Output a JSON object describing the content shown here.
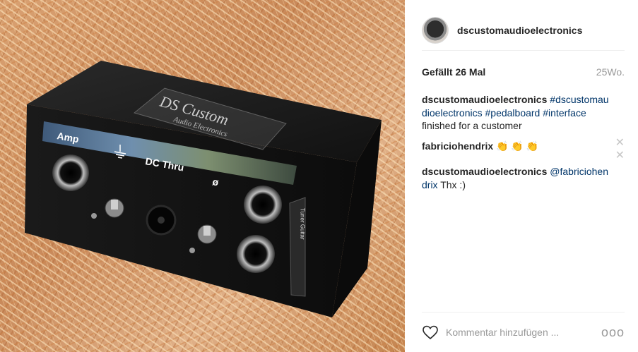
{
  "post": {
    "username": "dscustomaudioelectronics",
    "likes": "Gefällt 26 Mal",
    "time": "25Wo."
  },
  "photo": {
    "panel_top_left": "Amp",
    "panel_top_mid": "DC Thru",
    "panel_top_right": "ø",
    "logo_line1": "DS Custom",
    "logo_line2": "Audio Electronics",
    "side_label": "Tuner Guitar"
  },
  "comments": [
    {
      "user": "dscustomaudioelectronics",
      "tags": [
        "#dscustomaudioelectronics",
        "#pedalboard",
        "#interface"
      ],
      "text": "finished for a customer"
    },
    {
      "user": "fabriciohendrix",
      "text": "👏 👏 👏"
    },
    {
      "user": "dscustomaudioelectronics",
      "mention": "@fabriciohendrix",
      "text": "Thx :)"
    }
  ],
  "footer": {
    "placeholder": "Kommentar hinzufügen ...",
    "more": "ooo"
  },
  "icons": {
    "remove": "close-icon",
    "like": "heart-outline-icon",
    "options": "more-options-icon"
  },
  "colors": {
    "link": "#003569",
    "muted": "#999999",
    "text": "#262626"
  }
}
